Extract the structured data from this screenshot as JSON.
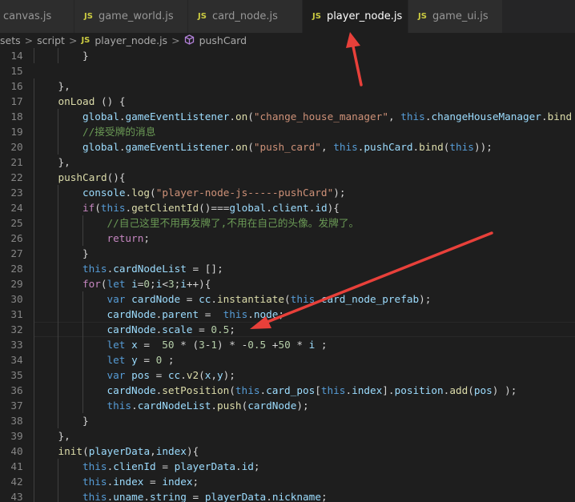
{
  "tabs": [
    {
      "label": "canvas.js",
      "js": false,
      "active": false
    },
    {
      "label": "game_world.js",
      "js": true,
      "active": false
    },
    {
      "label": "card_node.js",
      "js": true,
      "active": false
    },
    {
      "label": "player_node.js",
      "js": true,
      "active": true
    },
    {
      "label": "game_ui.js",
      "js": true,
      "active": false
    }
  ],
  "js_badge": "JS",
  "close_glyph": "×",
  "breadcrumb": {
    "part1": "sets",
    "part2": "script",
    "file": "player_node.js",
    "symbol": "pushCard",
    "separator": ">"
  },
  "lines": [
    {
      "n": "14",
      "indent": 2,
      "tokens": [
        [
          "p",
          "}"
        ]
      ]
    },
    {
      "n": "15",
      "indent": 0,
      "tokens": []
    },
    {
      "n": "16",
      "indent": 1,
      "tokens": [
        [
          "p",
          "},"
        ]
      ]
    },
    {
      "n": "17",
      "indent": 1,
      "tokens": [
        [
          "fn",
          "onLoad"
        ],
        [
          "p",
          " () {"
        ]
      ]
    },
    {
      "n": "18",
      "indent": 2,
      "tokens": [
        [
          "var",
          "global"
        ],
        [
          "p",
          "."
        ],
        [
          "var",
          "gameEventListener"
        ],
        [
          "p",
          "."
        ],
        [
          "fn",
          "on"
        ],
        [
          "p",
          "("
        ],
        [
          "str",
          "\"change_house_manager\""
        ],
        [
          "p",
          ", "
        ],
        [
          "kw",
          "this"
        ],
        [
          "p",
          "."
        ],
        [
          "var",
          "changeHouseManager"
        ],
        [
          "p",
          "."
        ],
        [
          "fn",
          "bind"
        ]
      ]
    },
    {
      "n": "19",
      "indent": 2,
      "tokens": [
        [
          "cm",
          "//接受牌的消息"
        ]
      ]
    },
    {
      "n": "20",
      "indent": 2,
      "tokens": [
        [
          "var",
          "global"
        ],
        [
          "p",
          "."
        ],
        [
          "var",
          "gameEventListener"
        ],
        [
          "p",
          "."
        ],
        [
          "fn",
          "on"
        ],
        [
          "p",
          "("
        ],
        [
          "str",
          "\"push_card\""
        ],
        [
          "p",
          ", "
        ],
        [
          "kw",
          "this"
        ],
        [
          "p",
          "."
        ],
        [
          "var",
          "pushCard"
        ],
        [
          "p",
          "."
        ],
        [
          "fn",
          "bind"
        ],
        [
          "p",
          "("
        ],
        [
          "kw",
          "this"
        ],
        [
          "p",
          "));"
        ]
      ]
    },
    {
      "n": "21",
      "indent": 1,
      "tokens": [
        [
          "p",
          "},"
        ]
      ]
    },
    {
      "n": "22",
      "indent": 1,
      "tokens": [
        [
          "fn",
          "pushCard"
        ],
        [
          "p",
          "(){"
        ]
      ]
    },
    {
      "n": "23",
      "indent": 2,
      "tokens": [
        [
          "var",
          "console"
        ],
        [
          "p",
          "."
        ],
        [
          "fn",
          "log"
        ],
        [
          "p",
          "("
        ],
        [
          "str",
          "\"player-node-js-----pushCard\""
        ],
        [
          "p",
          ");"
        ]
      ]
    },
    {
      "n": "24",
      "indent": 2,
      "tokens": [
        [
          "ctl",
          "if"
        ],
        [
          "p",
          "("
        ],
        [
          "kw",
          "this"
        ],
        [
          "p",
          "."
        ],
        [
          "fn",
          "getClientId"
        ],
        [
          "p",
          "()==="
        ],
        [
          "var",
          "global"
        ],
        [
          "p",
          "."
        ],
        [
          "var",
          "client"
        ],
        [
          "p",
          "."
        ],
        [
          "var",
          "id"
        ],
        [
          "p",
          "){"
        ]
      ]
    },
    {
      "n": "25",
      "indent": 3,
      "tokens": [
        [
          "cm",
          "//自己这里不用再发牌了,不用在自己的头像。发牌了。"
        ]
      ]
    },
    {
      "n": "26",
      "indent": 3,
      "tokens": [
        [
          "ctl",
          "return"
        ],
        [
          "p",
          ";"
        ]
      ]
    },
    {
      "n": "27",
      "indent": 2,
      "tokens": [
        [
          "p",
          "}"
        ]
      ]
    },
    {
      "n": "28",
      "indent": 2,
      "tokens": [
        [
          "kw",
          "this"
        ],
        [
          "p",
          "."
        ],
        [
          "var",
          "cardNodeList"
        ],
        [
          "p",
          " = [];"
        ]
      ]
    },
    {
      "n": "29",
      "indent": 2,
      "tokens": [
        [
          "ctl",
          "for"
        ],
        [
          "p",
          "("
        ],
        [
          "kw",
          "let"
        ],
        [
          "p",
          " "
        ],
        [
          "var",
          "i"
        ],
        [
          "p",
          "="
        ],
        [
          "num",
          "0"
        ],
        [
          "p",
          ";"
        ],
        [
          "var",
          "i"
        ],
        [
          "p",
          "<"
        ],
        [
          "num",
          "3"
        ],
        [
          "p",
          ";"
        ],
        [
          "var",
          "i"
        ],
        [
          "p",
          "++){"
        ]
      ]
    },
    {
      "n": "30",
      "indent": 3,
      "tokens": [
        [
          "kw",
          "var"
        ],
        [
          "p",
          " "
        ],
        [
          "var",
          "cardNode"
        ],
        [
          "p",
          " = "
        ],
        [
          "var",
          "cc"
        ],
        [
          "p",
          "."
        ],
        [
          "fn",
          "instantiate"
        ],
        [
          "p",
          "("
        ],
        [
          "kw",
          "this"
        ],
        [
          "p",
          "."
        ],
        [
          "var",
          "card_node_prefab"
        ],
        [
          "p",
          ");"
        ]
      ]
    },
    {
      "n": "31",
      "indent": 3,
      "tokens": [
        [
          "var",
          "cardNode"
        ],
        [
          "p",
          "."
        ],
        [
          "var",
          "parent"
        ],
        [
          "p",
          " =  "
        ],
        [
          "kw",
          "this"
        ],
        [
          "p",
          "."
        ],
        [
          "var",
          "node"
        ],
        [
          "p",
          ";"
        ]
      ]
    },
    {
      "n": "32",
      "indent": 3,
      "tokens": [
        [
          "var",
          "cardNode"
        ],
        [
          "p",
          "."
        ],
        [
          "var",
          "scale"
        ],
        [
          "p",
          " = "
        ],
        [
          "num",
          "0.5"
        ],
        [
          "p",
          ";"
        ]
      ],
      "current": true
    },
    {
      "n": "33",
      "indent": 3,
      "tokens": [
        [
          "kw",
          "let"
        ],
        [
          "p",
          " "
        ],
        [
          "var",
          "x"
        ],
        [
          "p",
          " =  "
        ],
        [
          "num",
          "50"
        ],
        [
          "p",
          " * ("
        ],
        [
          "num",
          "3"
        ],
        [
          "p",
          "-"
        ],
        [
          "num",
          "1"
        ],
        [
          "p",
          ") * -"
        ],
        [
          "num",
          "0.5"
        ],
        [
          "p",
          " +"
        ],
        [
          "num",
          "50"
        ],
        [
          "p",
          " * "
        ],
        [
          "var",
          "i"
        ],
        [
          "p",
          " ;"
        ]
      ]
    },
    {
      "n": "34",
      "indent": 3,
      "tokens": [
        [
          "kw",
          "let"
        ],
        [
          "p",
          " "
        ],
        [
          "var",
          "y"
        ],
        [
          "p",
          " = "
        ],
        [
          "num",
          "0"
        ],
        [
          "p",
          " ;"
        ]
      ]
    },
    {
      "n": "35",
      "indent": 3,
      "tokens": [
        [
          "kw",
          "var"
        ],
        [
          "p",
          " "
        ],
        [
          "var",
          "pos"
        ],
        [
          "p",
          " = "
        ],
        [
          "var",
          "cc"
        ],
        [
          "p",
          "."
        ],
        [
          "fn",
          "v2"
        ],
        [
          "p",
          "("
        ],
        [
          "var",
          "x"
        ],
        [
          "p",
          ","
        ],
        [
          "var",
          "y"
        ],
        [
          "p",
          ");"
        ]
      ]
    },
    {
      "n": "36",
      "indent": 3,
      "tokens": [
        [
          "var",
          "cardNode"
        ],
        [
          "p",
          "."
        ],
        [
          "fn",
          "setPosition"
        ],
        [
          "p",
          "("
        ],
        [
          "kw",
          "this"
        ],
        [
          "p",
          "."
        ],
        [
          "var",
          "card_pos"
        ],
        [
          "p",
          "["
        ],
        [
          "kw",
          "this"
        ],
        [
          "p",
          "."
        ],
        [
          "var",
          "index"
        ],
        [
          "p",
          "]."
        ],
        [
          "var",
          "position"
        ],
        [
          "p",
          "."
        ],
        [
          "fn",
          "add"
        ],
        [
          "p",
          "("
        ],
        [
          "var",
          "pos"
        ],
        [
          "p",
          ") );"
        ]
      ]
    },
    {
      "n": "37",
      "indent": 3,
      "tokens": [
        [
          "kw",
          "this"
        ],
        [
          "p",
          "."
        ],
        [
          "var",
          "cardNodeList"
        ],
        [
          "p",
          "."
        ],
        [
          "fn",
          "push"
        ],
        [
          "p",
          "("
        ],
        [
          "var",
          "cardNode"
        ],
        [
          "p",
          ");"
        ]
      ]
    },
    {
      "n": "38",
      "indent": 2,
      "tokens": [
        [
          "p",
          "}"
        ]
      ]
    },
    {
      "n": "39",
      "indent": 1,
      "tokens": [
        [
          "p",
          "},"
        ]
      ]
    },
    {
      "n": "40",
      "indent": 1,
      "tokens": [
        [
          "fn",
          "init"
        ],
        [
          "p",
          "("
        ],
        [
          "var",
          "playerData"
        ],
        [
          "p",
          ","
        ],
        [
          "var",
          "index"
        ],
        [
          "p",
          "){"
        ]
      ]
    },
    {
      "n": "41",
      "indent": 2,
      "tokens": [
        [
          "kw",
          "this"
        ],
        [
          "p",
          "."
        ],
        [
          "var",
          "clienId"
        ],
        [
          "p",
          " = "
        ],
        [
          "var",
          "playerData"
        ],
        [
          "p",
          "."
        ],
        [
          "var",
          "id"
        ],
        [
          "p",
          ";"
        ]
      ]
    },
    {
      "n": "42",
      "indent": 2,
      "tokens": [
        [
          "kw",
          "this"
        ],
        [
          "p",
          "."
        ],
        [
          "var",
          "index"
        ],
        [
          "p",
          " = "
        ],
        [
          "var",
          "index"
        ],
        [
          "p",
          ";"
        ]
      ]
    },
    {
      "n": "43",
      "indent": 2,
      "tokens": [
        [
          "kw",
          "this"
        ],
        [
          "p",
          "."
        ],
        [
          "var",
          "uname"
        ],
        [
          "p",
          "."
        ],
        [
          "var",
          "string"
        ],
        [
          "p",
          " = "
        ],
        [
          "var",
          "playerData"
        ],
        [
          "p",
          "."
        ],
        [
          "var",
          "nickname"
        ],
        [
          "p",
          ";"
        ]
      ]
    }
  ],
  "colors": {
    "background": "#1e1e1e",
    "annotation_red": "#e8403a",
    "keyword": "#569cd6",
    "string": "#ce9178",
    "comment": "#6a9955"
  }
}
